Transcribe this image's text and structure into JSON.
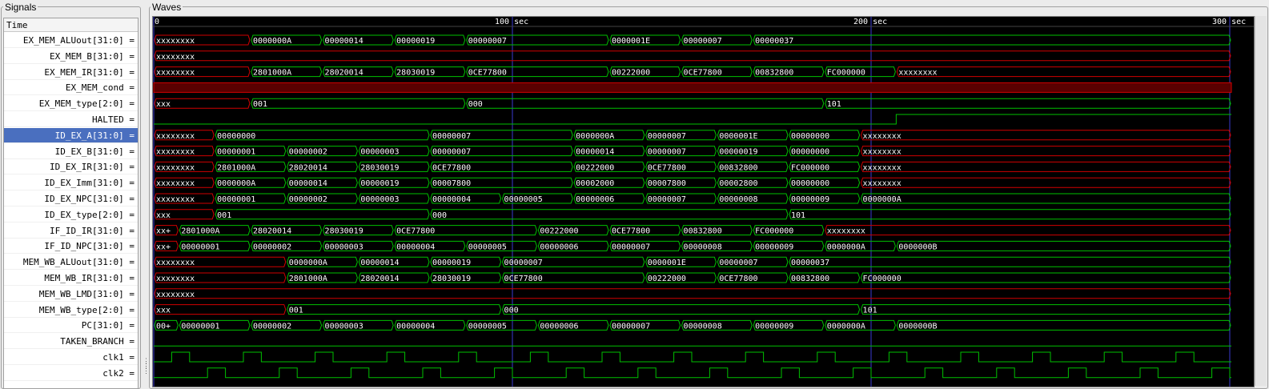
{
  "signals_title": "Signals",
  "waves_title": "Waves",
  "time_header": "Time",
  "time_markers": [
    "0",
    "100 sec",
    "200 sec",
    "300 sec"
  ],
  "colors": {
    "valid": "#00c000",
    "unknown": "#d00000",
    "cursor": "#3a3acf",
    "bg": "#000000"
  },
  "selected_signal": "ID_EX_A[31:0]",
  "signals": [
    {
      "name": "EX_MEM_ALUout[31:0] =",
      "kind": "bus",
      "segments": [
        {
          "t": 0,
          "label": "xxxxxxxx",
          "x": true
        },
        {
          "t": 27,
          "label": "0000000A"
        },
        {
          "t": 47,
          "label": "00000014"
        },
        {
          "t": 67,
          "label": "00000019"
        },
        {
          "t": 87,
          "label": "00000007"
        },
        {
          "t": 127,
          "label": "0000001E"
        },
        {
          "t": 147,
          "label": "00000007"
        },
        {
          "t": 167,
          "label": "00000037"
        }
      ]
    },
    {
      "name": "EX_MEM_B[31:0] =",
      "kind": "bus",
      "segments": [
        {
          "t": 0,
          "label": "xxxxxxxx",
          "x": true
        }
      ]
    },
    {
      "name": "EX_MEM_IR[31:0] =",
      "kind": "bus",
      "segments": [
        {
          "t": 0,
          "label": "xxxxxxxx",
          "x": true
        },
        {
          "t": 27,
          "label": "2801000A"
        },
        {
          "t": 47,
          "label": "28020014"
        },
        {
          "t": 67,
          "label": "28030019"
        },
        {
          "t": 87,
          "label": "0CE77800"
        },
        {
          "t": 127,
          "label": "00222000"
        },
        {
          "t": 147,
          "label": "0CE77800"
        },
        {
          "t": 167,
          "label": "00832800"
        },
        {
          "t": 187,
          "label": "FC000000"
        },
        {
          "t": 207,
          "label": "xxxxxxxx",
          "x": true
        }
      ]
    },
    {
      "name": "EX_MEM_cond =",
      "kind": "xbit"
    },
    {
      "name": "EX_MEM_type[2:0] =",
      "kind": "bus",
      "segments": [
        {
          "t": 0,
          "label": "xxx",
          "x": true
        },
        {
          "t": 27,
          "label": "001"
        },
        {
          "t": 87,
          "label": "000"
        },
        {
          "t": 187,
          "label": "101"
        }
      ]
    },
    {
      "name": "HALTED =",
      "kind": "bit",
      "edges": [
        {
          "t": 207,
          "v": 1
        }
      ]
    },
    {
      "name": "ID_EX_A[31:0] =",
      "kind": "bus",
      "segments": [
        {
          "t": 0,
          "label": "xxxxxxxx",
          "x": true
        },
        {
          "t": 17,
          "label": "00000000"
        },
        {
          "t": 77,
          "label": "00000007"
        },
        {
          "t": 117,
          "label": "0000000A"
        },
        {
          "t": 137,
          "label": "00000007"
        },
        {
          "t": 157,
          "label": "0000001E"
        },
        {
          "t": 177,
          "label": "00000000"
        },
        {
          "t": 197,
          "label": "xxxxxxxx",
          "x": true
        }
      ]
    },
    {
      "name": "ID_EX_B[31:0] =",
      "kind": "bus",
      "segments": [
        {
          "t": 0,
          "label": "xxxxxxxx",
          "x": true
        },
        {
          "t": 17,
          "label": "00000001"
        },
        {
          "t": 37,
          "label": "00000002"
        },
        {
          "t": 57,
          "label": "00000003"
        },
        {
          "t": 77,
          "label": "00000007"
        },
        {
          "t": 117,
          "label": "00000014"
        },
        {
          "t": 137,
          "label": "00000007"
        },
        {
          "t": 157,
          "label": "00000019"
        },
        {
          "t": 177,
          "label": "00000000"
        },
        {
          "t": 197,
          "label": "xxxxxxxx",
          "x": true
        }
      ]
    },
    {
      "name": "ID_EX_IR[31:0] =",
      "kind": "bus",
      "segments": [
        {
          "t": 0,
          "label": "xxxxxxxx",
          "x": true
        },
        {
          "t": 17,
          "label": "2801000A"
        },
        {
          "t": 37,
          "label": "28020014"
        },
        {
          "t": 57,
          "label": "28030019"
        },
        {
          "t": 77,
          "label": "0CE77800"
        },
        {
          "t": 117,
          "label": "00222000"
        },
        {
          "t": 137,
          "label": "0CE77800"
        },
        {
          "t": 157,
          "label": "00832800"
        },
        {
          "t": 177,
          "label": "FC000000"
        },
        {
          "t": 197,
          "label": "xxxxxxxx",
          "x": true
        }
      ]
    },
    {
      "name": "ID_EX_Imm[31:0] =",
      "kind": "bus",
      "segments": [
        {
          "t": 0,
          "label": "xxxxxxxx",
          "x": true
        },
        {
          "t": 17,
          "label": "0000000A"
        },
        {
          "t": 37,
          "label": "00000014"
        },
        {
          "t": 57,
          "label": "00000019"
        },
        {
          "t": 77,
          "label": "00007800"
        },
        {
          "t": 117,
          "label": "00002000"
        },
        {
          "t": 137,
          "label": "00007800"
        },
        {
          "t": 157,
          "label": "00002800"
        },
        {
          "t": 177,
          "label": "00000000"
        },
        {
          "t": 197,
          "label": "xxxxxxxx",
          "x": true
        }
      ]
    },
    {
      "name": "ID_EX_NPC[31:0] =",
      "kind": "bus",
      "segments": [
        {
          "t": 0,
          "label": "xxxxxxxx",
          "x": true
        },
        {
          "t": 17,
          "label": "00000001"
        },
        {
          "t": 37,
          "label": "00000002"
        },
        {
          "t": 57,
          "label": "00000003"
        },
        {
          "t": 77,
          "label": "00000004"
        },
        {
          "t": 97,
          "label": "00000005"
        },
        {
          "t": 117,
          "label": "00000006"
        },
        {
          "t": 137,
          "label": "00000007"
        },
        {
          "t": 157,
          "label": "00000008"
        },
        {
          "t": 177,
          "label": "00000009"
        },
        {
          "t": 197,
          "label": "0000000A"
        }
      ]
    },
    {
      "name": "ID_EX_type[2:0] =",
      "kind": "bus",
      "segments": [
        {
          "t": 0,
          "label": "xxx",
          "x": true
        },
        {
          "t": 17,
          "label": "001"
        },
        {
          "t": 77,
          "label": "000"
        },
        {
          "t": 177,
          "label": "101"
        }
      ]
    },
    {
      "name": "IF_ID_IR[31:0] =",
      "kind": "bus",
      "segments": [
        {
          "t": 0,
          "label": "xx+",
          "x": true
        },
        {
          "t": 7,
          "label": "2801000A"
        },
        {
          "t": 27,
          "label": "28020014"
        },
        {
          "t": 47,
          "label": "28030019"
        },
        {
          "t": 67,
          "label": "0CE77800"
        },
        {
          "t": 107,
          "label": "00222000"
        },
        {
          "t": 127,
          "label": "0CE77800"
        },
        {
          "t": 147,
          "label": "00832800"
        },
        {
          "t": 167,
          "label": "FC000000"
        },
        {
          "t": 187,
          "label": "xxxxxxxx",
          "x": true
        }
      ]
    },
    {
      "name": "IF_ID_NPC[31:0] =",
      "kind": "bus",
      "segments": [
        {
          "t": 0,
          "label": "xx+",
          "x": true
        },
        {
          "t": 7,
          "label": "00000001"
        },
        {
          "t": 27,
          "label": "00000002"
        },
        {
          "t": 47,
          "label": "00000003"
        },
        {
          "t": 67,
          "label": "00000004"
        },
        {
          "t": 87,
          "label": "00000005"
        },
        {
          "t": 107,
          "label": "00000006"
        },
        {
          "t": 127,
          "label": "00000007"
        },
        {
          "t": 147,
          "label": "00000008"
        },
        {
          "t": 167,
          "label": "00000009"
        },
        {
          "t": 187,
          "label": "0000000A"
        },
        {
          "t": 207,
          "label": "0000000B"
        }
      ]
    },
    {
      "name": "MEM_WB_ALUout[31:0] =",
      "kind": "bus",
      "segments": [
        {
          "t": 0,
          "label": "xxxxxxxx",
          "x": true
        },
        {
          "t": 37,
          "label": "0000000A"
        },
        {
          "t": 57,
          "label": "00000014"
        },
        {
          "t": 77,
          "label": "00000019"
        },
        {
          "t": 97,
          "label": "00000007"
        },
        {
          "t": 137,
          "label": "0000001E"
        },
        {
          "t": 157,
          "label": "00000007"
        },
        {
          "t": 177,
          "label": "00000037"
        }
      ]
    },
    {
      "name": "MEM_WB_IR[31:0] =",
      "kind": "bus",
      "segments": [
        {
          "t": 0,
          "label": "xxxxxxxx",
          "x": true
        },
        {
          "t": 37,
          "label": "2801000A"
        },
        {
          "t": 57,
          "label": "28020014"
        },
        {
          "t": 77,
          "label": "28030019"
        },
        {
          "t": 97,
          "label": "0CE77800"
        },
        {
          "t": 137,
          "label": "00222000"
        },
        {
          "t": 157,
          "label": "0CE77800"
        },
        {
          "t": 177,
          "label": "00832800"
        },
        {
          "t": 197,
          "label": "FC000000"
        }
      ]
    },
    {
      "name": "MEM_WB_LMD[31:0] =",
      "kind": "bus",
      "segments": [
        {
          "t": 0,
          "label": "xxxxxxxx",
          "x": true
        }
      ]
    },
    {
      "name": "MEM_WB_type[2:0] =",
      "kind": "bus",
      "segments": [
        {
          "t": 0,
          "label": "xxx",
          "x": true
        },
        {
          "t": 37,
          "label": "001"
        },
        {
          "t": 97,
          "label": "000"
        },
        {
          "t": 197,
          "label": "101"
        }
      ]
    },
    {
      "name": "PC[31:0] =",
      "kind": "bus",
      "segments": [
        {
          "t": 0,
          "label": "00+"
        },
        {
          "t": 7,
          "label": "00000001"
        },
        {
          "t": 27,
          "label": "00000002"
        },
        {
          "t": 47,
          "label": "00000003"
        },
        {
          "t": 67,
          "label": "00000004"
        },
        {
          "t": 87,
          "label": "00000005"
        },
        {
          "t": 107,
          "label": "00000006"
        },
        {
          "t": 127,
          "label": "00000007"
        },
        {
          "t": 147,
          "label": "00000008"
        },
        {
          "t": 167,
          "label": "00000009"
        },
        {
          "t": 187,
          "label": "0000000A"
        },
        {
          "t": 207,
          "label": "0000000B"
        }
      ]
    },
    {
      "name": "TAKEN_BRANCH =",
      "kind": "bit",
      "edges": []
    },
    {
      "name": "clk1 =",
      "kind": "clock",
      "offset": 5,
      "high": 5,
      "period": 20
    },
    {
      "name": "clk2 =",
      "kind": "clock",
      "offset": 15,
      "high": 5,
      "period": 20
    }
  ]
}
